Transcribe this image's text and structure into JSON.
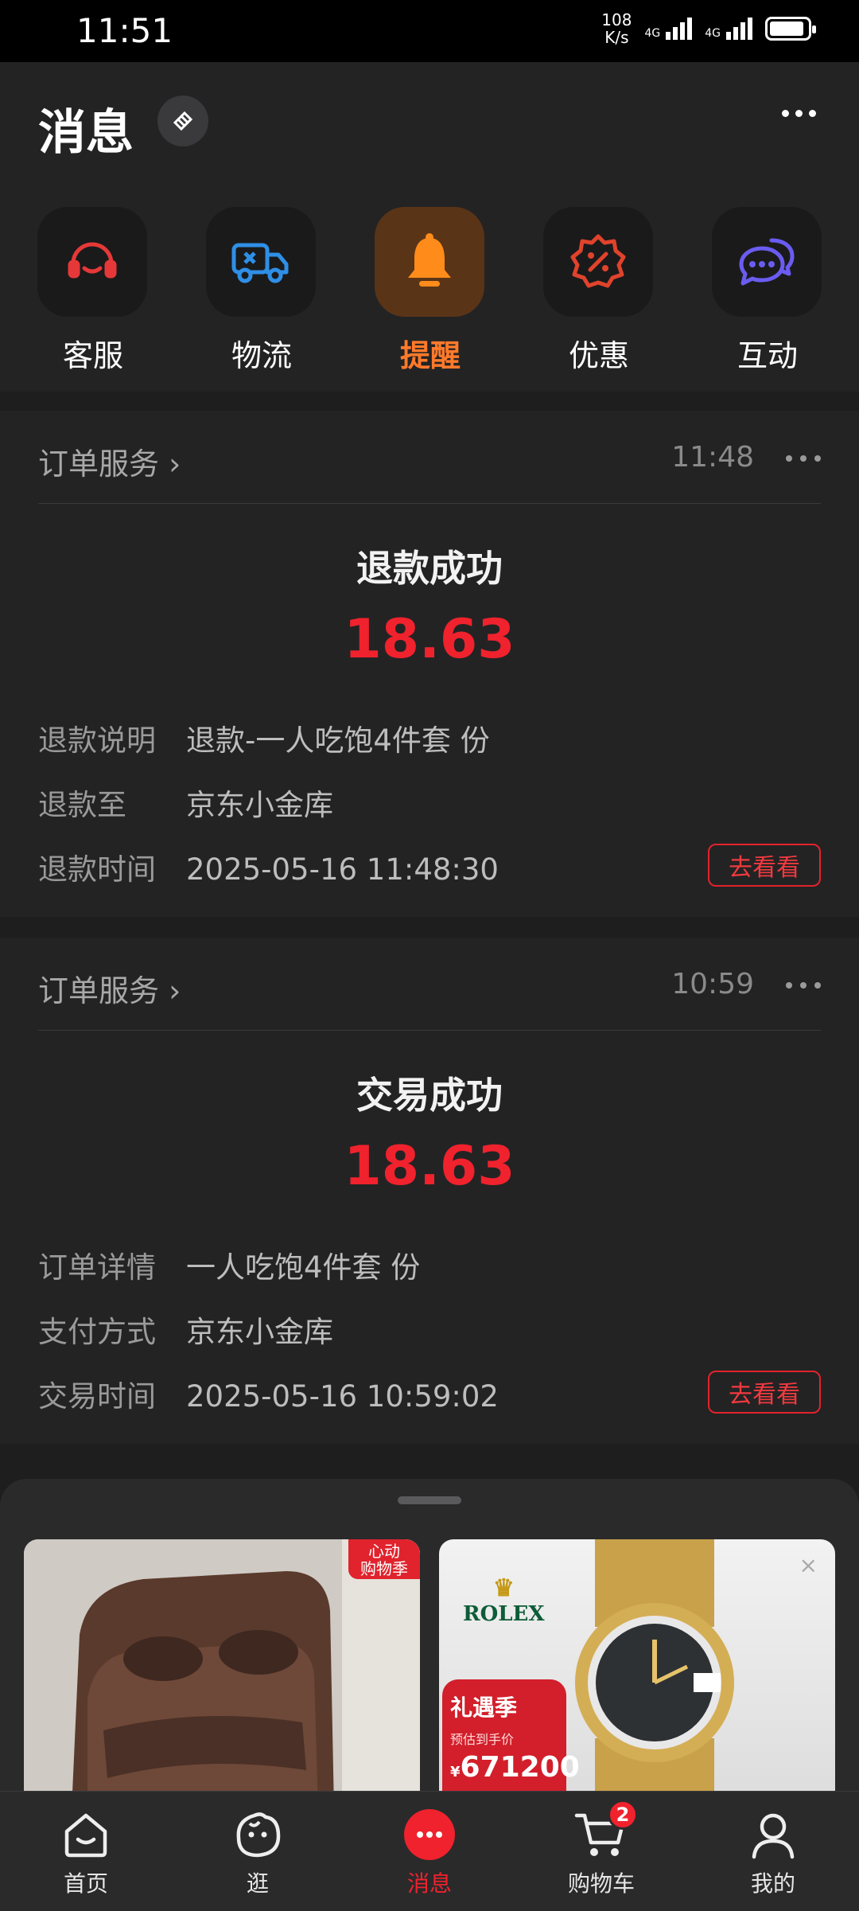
{
  "status_bar": {
    "time": "11:51",
    "speed": "108",
    "speed_unit": "K/s",
    "net1": "4G",
    "net2": "4G"
  },
  "header": {
    "title": "消息"
  },
  "categories": [
    {
      "label": "客服",
      "icon": "headset-icon",
      "active": false
    },
    {
      "label": "物流",
      "icon": "truck-icon",
      "active": false
    },
    {
      "label": "提醒",
      "icon": "bell-icon",
      "active": true
    },
    {
      "label": "优惠",
      "icon": "discount-badge-icon",
      "active": false
    },
    {
      "label": "互动",
      "icon": "chat-bubbles-icon",
      "active": false
    }
  ],
  "cards": [
    {
      "source": "订单服务 ›",
      "time": "11:48",
      "title": "退款成功",
      "amount": "18.63",
      "rows": [
        {
          "key": "退款说明",
          "value": "退款-一人吃饱4件套 份"
        },
        {
          "key": "退款至",
          "value": "京东小金库"
        },
        {
          "key": "退款时间",
          "value": "2025-05-16 11:48:30"
        }
      ],
      "button": "去看看"
    },
    {
      "source": "订单服务 ›",
      "time": "10:59",
      "title": "交易成功",
      "amount": "18.63",
      "rows": [
        {
          "key": "订单详情",
          "value": "一人吃饱4件套 份"
        },
        {
          "key": "支付方式",
          "value": "京东小金库"
        },
        {
          "key": "交易时间",
          "value": "2025-05-16 10:59:02"
        }
      ],
      "button": "去看看"
    }
  ],
  "recommend": {
    "item1": {
      "tag_line1": "心动",
      "tag_line2": "购物季"
    },
    "item2": {
      "brand": "ROLEX",
      "promo_title": "礼遇季",
      "promo_sub": "预估到手价",
      "currency": "¥",
      "price": "671200"
    }
  },
  "nav": [
    {
      "label": "首页",
      "icon": "home-icon",
      "active": false
    },
    {
      "label": "逛",
      "icon": "stroll-face-icon",
      "active": false
    },
    {
      "label": "消息",
      "icon": "message-icon",
      "active": true
    },
    {
      "label": "购物车",
      "icon": "cart-icon",
      "active": false,
      "badge": "2"
    },
    {
      "label": "我的",
      "icon": "profile-icon",
      "active": false
    }
  ],
  "colors": {
    "accent_red": "#f0222d",
    "active_orange": "#ff7a2b",
    "background": "#1e1e1f",
    "card": "#232324"
  }
}
